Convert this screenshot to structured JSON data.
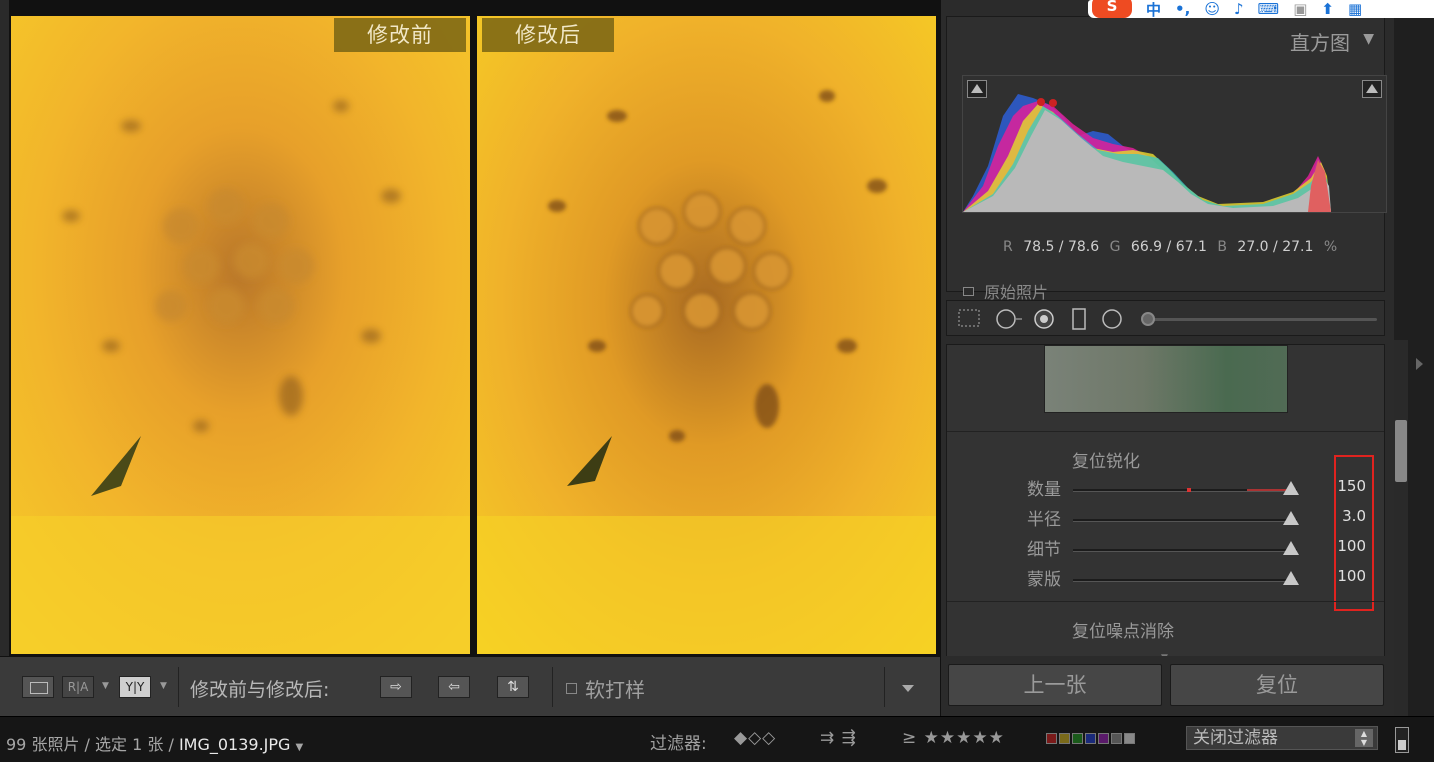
{
  "preview": {
    "before_label": "修改前",
    "after_label": "修改后"
  },
  "histogram": {
    "title": "直方图",
    "readout": {
      "r_letter": "R",
      "r_value": "78.5 / 78.6",
      "g_letter": "G",
      "g_value": "66.9 / 67.1",
      "b_letter": "B",
      "b_value": "27.0 / 27.1",
      "unit": "%"
    },
    "original_photo_label": "原始照片"
  },
  "detail": {
    "sharpen_reset": "复位锐化",
    "sliders": [
      {
        "label": "数量",
        "value": "150"
      },
      {
        "label": "半径",
        "value": "3.0"
      },
      {
        "label": "细节",
        "value": "100"
      },
      {
        "label": "蒙版",
        "value": "100"
      }
    ],
    "noise_reset": "复位噪点消除"
  },
  "buttons": {
    "prev": "上一张",
    "reset": "复位"
  },
  "toolbar": {
    "view_ra": "R|A",
    "view_yy": "Y|Y",
    "before_after_label": "修改前与修改后:",
    "soft_proof_label": "软打样"
  },
  "filmstrip": {
    "count_text": "99 张照片 /  选定 1 张 /",
    "filename": "IMG_0139.JPG",
    "filter_label": "过滤器:",
    "filter_select": "关闭过滤器",
    "rating_prefix": "≥",
    "stars": "★★★★★"
  },
  "ime": {
    "logo": "S",
    "lang": "中"
  },
  "colors": {
    "accent_red": "#e0231f",
    "label_bg": "#786414"
  }
}
